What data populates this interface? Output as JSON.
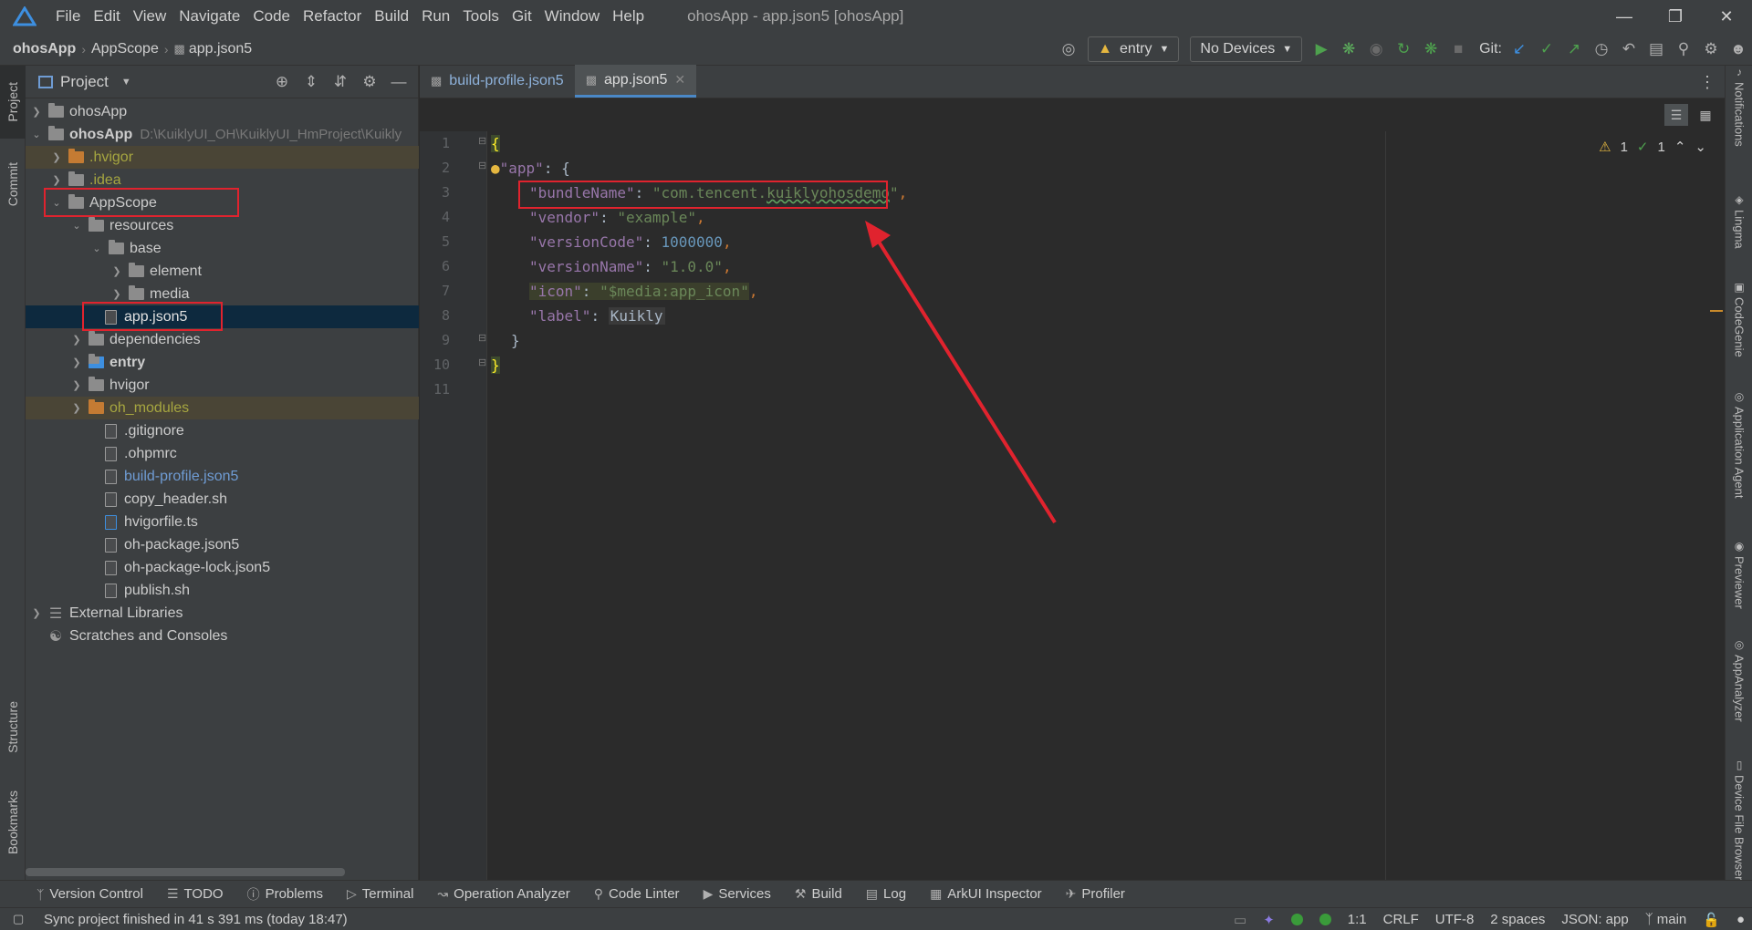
{
  "window": {
    "title": "ohosApp - app.json5 [ohosApp]",
    "menu": [
      {
        "label": "File"
      },
      {
        "label": "Edit"
      },
      {
        "label": "View"
      },
      {
        "label": "Navigate"
      },
      {
        "label": "Code"
      },
      {
        "label": "Refactor"
      },
      {
        "label": "Build"
      },
      {
        "label": "Run"
      },
      {
        "label": "Tools"
      },
      {
        "label": "Git"
      },
      {
        "label": "Window"
      },
      {
        "label": "Help"
      }
    ]
  },
  "breadcrumb": {
    "root": "ohosApp",
    "folder": "AppScope",
    "file": "app.json5"
  },
  "toolbar": {
    "run_config": "entry",
    "device": "No Devices",
    "git_label": "Git:"
  },
  "project_panel": {
    "title": "Project",
    "tree": [
      {
        "label": "ohosApp",
        "path": ""
      },
      {
        "label": "ohosApp",
        "path": "D:\\KuiklyUI_OH\\KuiklyUI_HmProject\\Kuikly"
      },
      {
        "label": ".hvigor"
      },
      {
        "label": ".idea"
      },
      {
        "label": "AppScope"
      },
      {
        "label": "resources"
      },
      {
        "label": "base"
      },
      {
        "label": "element"
      },
      {
        "label": "media"
      },
      {
        "label": "app.json5"
      },
      {
        "label": "dependencies"
      },
      {
        "label": "entry"
      },
      {
        "label": "hvigor"
      },
      {
        "label": "oh_modules"
      },
      {
        "label": ".gitignore"
      },
      {
        "label": ".ohpmrc"
      },
      {
        "label": "build-profile.json5"
      },
      {
        "label": "copy_header.sh"
      },
      {
        "label": "hvigorfile.ts"
      },
      {
        "label": "oh-package.json5"
      },
      {
        "label": "oh-package-lock.json5"
      },
      {
        "label": "publish.sh"
      },
      {
        "label": "External Libraries"
      },
      {
        "label": "Scratches and Consoles"
      }
    ]
  },
  "left_strip": {
    "project": "Project",
    "commit": "Commit",
    "structure": "Structure",
    "bookmarks": "Bookmarks"
  },
  "right_strip": {
    "notifications": "Notifications",
    "lingma": "Lingma",
    "codegenie": "CodeGenie",
    "app_agent": "Application Agent",
    "previewer": "Previewer",
    "appanalyzer": "AppAnalyzer",
    "device_file": "Device File Browser"
  },
  "editor_tabs": [
    {
      "label": "build-profile.json5"
    },
    {
      "label": "app.json5"
    }
  ],
  "editor": {
    "line_numbers": [
      "1",
      "2",
      "3",
      "4",
      "5",
      "6",
      "7",
      "8",
      "9",
      "10",
      "11"
    ],
    "warnings": "1",
    "checks": "1",
    "code": {
      "l2_key": "\"app\"",
      "bundle_key": "\"bundleName\"",
      "bundle_val_a": "\"com.tencent.",
      "bundle_val_b": "kuiklyohosdemo",
      "bundle_val_c": "\"",
      "vendor_key": "\"vendor\"",
      "vendor_val": "\"example\"",
      "vcode_key": "\"versionCode\"",
      "vcode_val": "1000000",
      "vname_key": "\"versionName\"",
      "vname_val": "\"1.0.0\"",
      "icon_key": "\"icon\"",
      "icon_val": "\"$media:app_icon\"",
      "label_key": "\"label\"",
      "label_val": "Kuikly"
    }
  },
  "bottom_tools": [
    {
      "label": "Version Control"
    },
    {
      "label": "TODO"
    },
    {
      "label": "Problems"
    },
    {
      "label": "Terminal"
    },
    {
      "label": "Operation Analyzer"
    },
    {
      "label": "Code Linter"
    },
    {
      "label": "Services"
    },
    {
      "label": "Build"
    },
    {
      "label": "Log"
    },
    {
      "label": "ArkUI Inspector"
    },
    {
      "label": "Profiler"
    }
  ],
  "status": {
    "message": "Sync project finished in 41 s 391 ms (today 18:47)",
    "position": "1:1",
    "line_sep": "CRLF",
    "encoding": "UTF-8",
    "indent": "2 spaces",
    "schema": "JSON: app",
    "branch": "main"
  },
  "colors": {
    "highlight_box": "#e0232e",
    "arrow": "#e0232e",
    "accent": "#4a88c7"
  }
}
